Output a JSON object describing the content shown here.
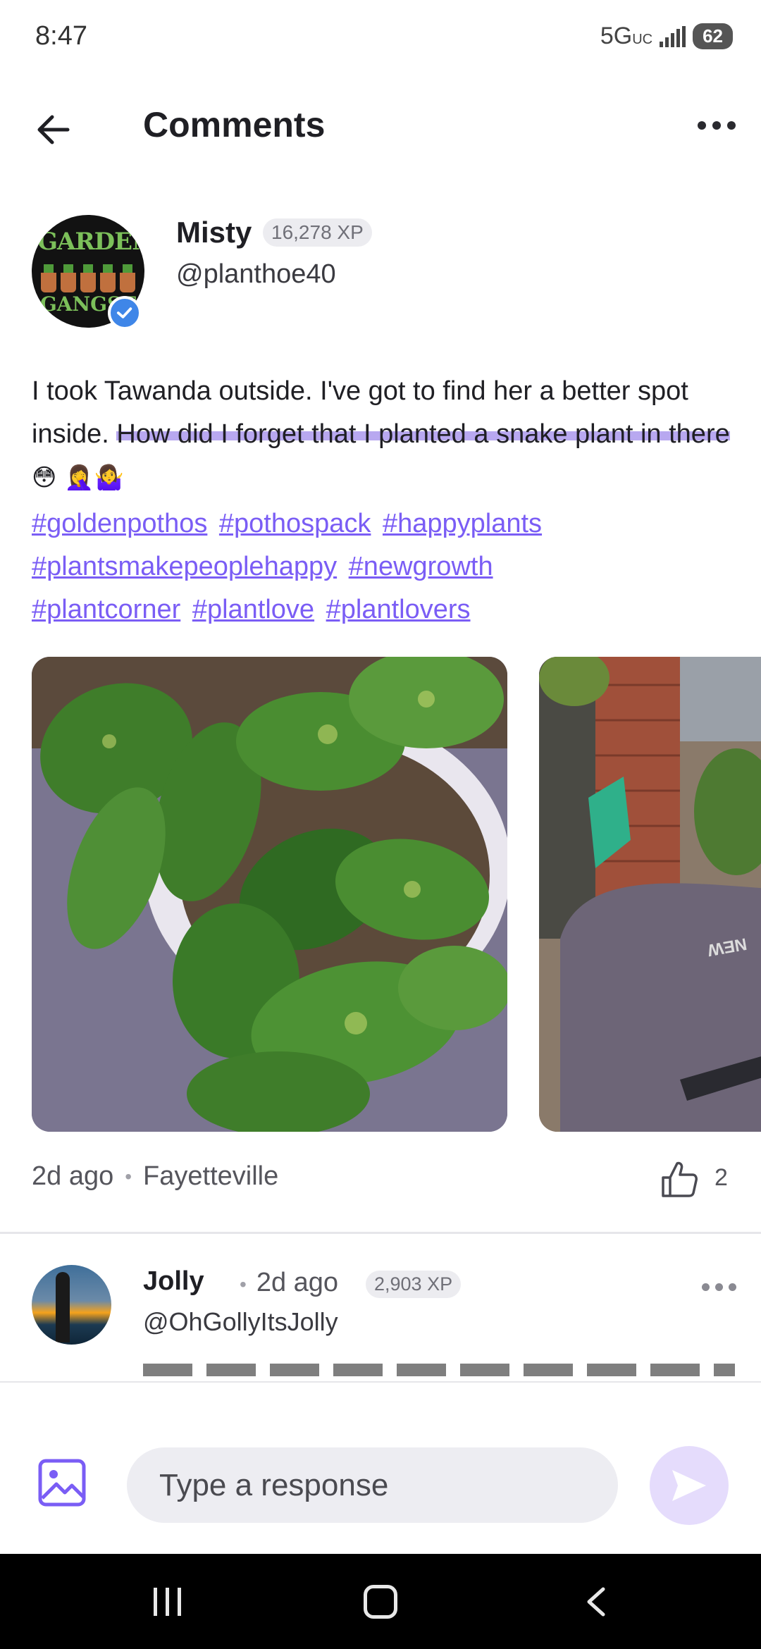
{
  "status_bar": {
    "time": "8:47",
    "network": "5G",
    "network_suffix": "UC",
    "battery": "62"
  },
  "header": {
    "title": "Comments"
  },
  "post": {
    "author_name": "Misty",
    "author_xp": "16,278 XP",
    "author_handle": "@planthoe40",
    "avatar_text_top": "GARDEN",
    "avatar_text_bottom": "GANGST",
    "text_plain": "I took Tawanda outside. I've got to find her a better spot inside. ",
    "text_highlighted": "How did I forget that I planted a snake plant in there",
    "emojis": "😳 🤦‍♀️🤷‍♀️",
    "hashtags": [
      "#goldenpothos",
      "#pothospack",
      "#happyplants",
      "#plantsmakepeoplehappy",
      "#newgrowth",
      "#plantcorner",
      "#plantlove",
      "#plantlovers"
    ],
    "time": "2d ago",
    "location": "Fayetteville",
    "likes": "2",
    "photo2_text": "NEW"
  },
  "comment": {
    "author_name": "Jolly",
    "time": "2d ago",
    "xp": "2,903 XP",
    "handle": "@OhGollyItsJolly"
  },
  "composer": {
    "placeholder": "Type a response"
  },
  "colors": {
    "accent": "#7a5df5",
    "highlight": "#b8a8f0",
    "send_button_bg": "#e5dcfc",
    "verified": "#3f86e8"
  }
}
